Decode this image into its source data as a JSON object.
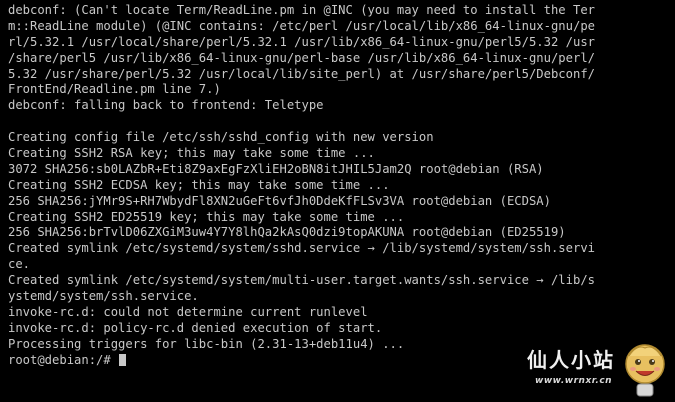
{
  "terminal": {
    "lines": [
      "debconf: (Can't locate Term/ReadLine.pm in @INC (you may need to install the Ter",
      "m::ReadLine module) (@INC contains: /etc/perl /usr/local/lib/x86_64-linux-gnu/pe",
      "rl/5.32.1 /usr/local/share/perl/5.32.1 /usr/lib/x86_64-linux-gnu/perl5/5.32 /usr",
      "/share/perl5 /usr/lib/x86_64-linux-gnu/perl-base /usr/lib/x86_64-linux-gnu/perl/",
      "5.32 /usr/share/perl/5.32 /usr/local/lib/site_perl) at /usr/share/perl5/Debconf/",
      "FrontEnd/Readline.pm line 7.)",
      "debconf: falling back to frontend: Teletype",
      "",
      "Creating config file /etc/ssh/sshd_config with new version",
      "Creating SSH2 RSA key; this may take some time ...",
      "3072 SHA256:sb0LAZbR+Eti8Z9axEgFzXliEH2oBN8itJHIL5Jam2Q root@debian (RSA)",
      "Creating SSH2 ECDSA key; this may take some time ...",
      "256 SHA256:jYMr9S+RH7WbydFl8XN2uGeFt6vfJh0DdeKfFLSv3VA root@debian (ECDSA)",
      "Creating SSH2 ED25519 key; this may take some time ...",
      "256 SHA256:brTvlD06ZXGiM3uw4Y7Y8lhQa2kAsQ0dzi9topAKUNA root@debian (ED25519)",
      "Created symlink /etc/systemd/system/sshd.service → /lib/systemd/system/ssh.servi",
      "ce.",
      "Created symlink /etc/systemd/system/multi-user.target.wants/ssh.service → /lib/s",
      "ystemd/system/ssh.service.",
      "invoke-rc.d: could not determine current runlevel",
      "invoke-rc.d: policy-rc.d denied execution of start.",
      "Processing triggers for libc-bin (2.31-13+deb11u4) ..."
    ],
    "prompt": "root@debian:/# "
  },
  "watermark": {
    "title": "仙人小站",
    "url": "www.wrnxr.cn",
    "mascot_icon": "cartoon-face-icon"
  },
  "colors": {
    "background": "#000000",
    "text": "#c8c8c8"
  }
}
